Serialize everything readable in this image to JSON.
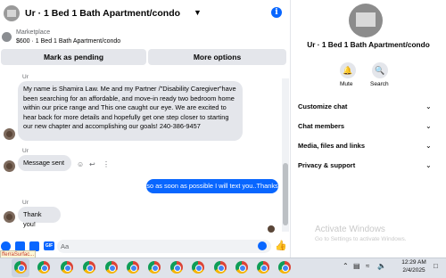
{
  "header": {
    "title": "Ur · 1 Bed 1 Bath Apartment/condo",
    "chevron_icon": "chevron-down-icon",
    "info_icon": "info-icon"
  },
  "marketplace": {
    "label": "Marketplace",
    "price_line": "$600 · 1 Bed 1 Bath Apartment/condo"
  },
  "actions": {
    "mark_pending": "Mark as pending",
    "more_options": "More options"
  },
  "messages": [
    {
      "sender": "Ur",
      "text": "My name is Shamira Law. Me and my Partner /\"Disability Caregiver\"have been searching for an affordable, and move-in ready two bedroom home within our price range and This one caught our eye. We are excited to hear back for more details and hopefully get one step closer to starting our new chapter and accomplishing our goals! 240-386-9457"
    },
    {
      "sender": "Ur",
      "text": "Message sent"
    },
    {
      "sender": "You",
      "text": "so as soon as possible I will text you..Thanks"
    },
    {
      "sender": "Ur",
      "text": "Thank you!"
    }
  ],
  "composer": {
    "placeholder": "Aa",
    "tooltip": "fferraSurfac..."
  },
  "side_panel": {
    "title": "Ur · 1 Bed 1 Bath Apartment/condo",
    "mute_label": "Mute",
    "search_label": "Search",
    "sections": [
      "Customize chat",
      "Chat members",
      "Media, files and links",
      "Privacy & support"
    ]
  },
  "watermark": {
    "title": "Activate Windows",
    "subtitle": "Go to Settings to activate Windows."
  },
  "taskbar": {
    "time": "12:29 AM",
    "date": "2/4/2025"
  },
  "colors": {
    "accent": "#0866ff",
    "bubble_gray": "#e4e6eb"
  }
}
